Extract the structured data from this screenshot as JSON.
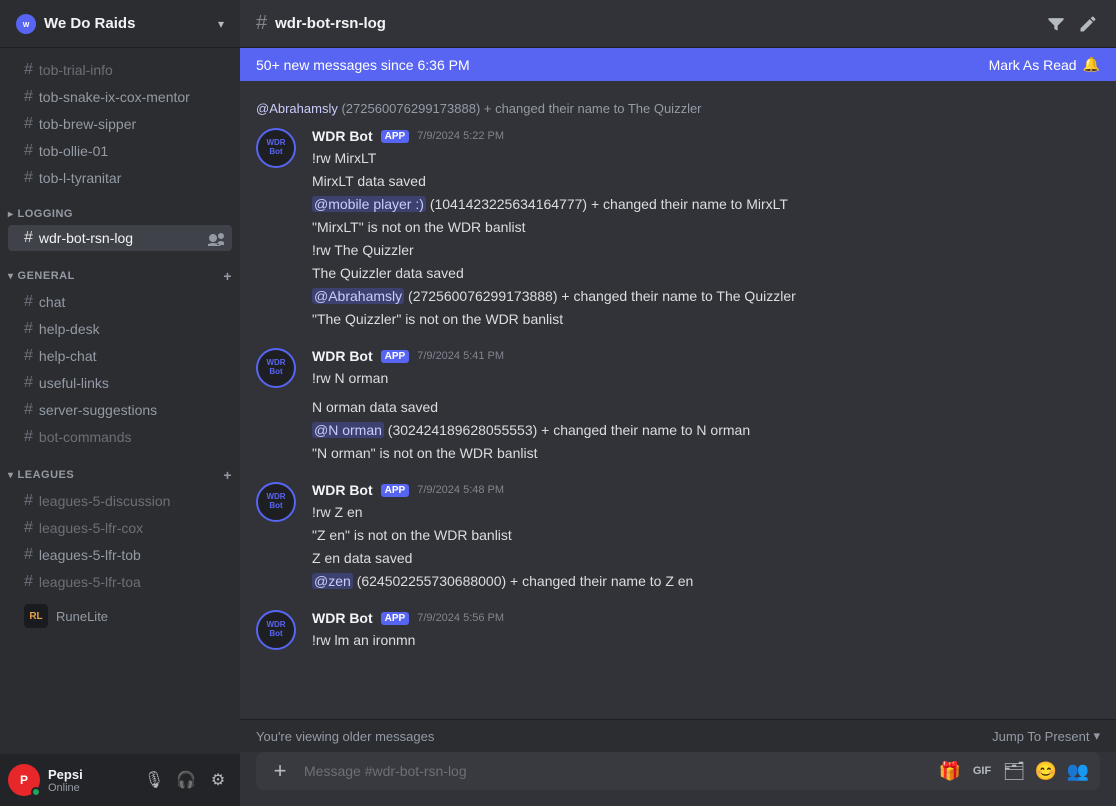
{
  "server": {
    "name": "We Do Raids",
    "icon_label": "WD"
  },
  "sidebar": {
    "channels_top": [
      {
        "name": "tob-trial-info",
        "muted": true
      },
      {
        "name": "tob-snake-ix-cox-mentor",
        "muted": false
      },
      {
        "name": "tob-brew-sipper",
        "muted": false
      },
      {
        "name": "tob-ollie-01",
        "muted": false
      },
      {
        "name": "tob-l-tyranitar",
        "muted": false
      }
    ],
    "categories": [
      {
        "name": "LOGGING",
        "channels": [
          {
            "name": "wdr-bot-rsn-log",
            "active": true
          }
        ]
      },
      {
        "name": "GENERAL",
        "channels": [
          {
            "name": "chat"
          },
          {
            "name": "help-desk"
          },
          {
            "name": "help-chat"
          },
          {
            "name": "useful-links"
          },
          {
            "name": "server-suggestions"
          },
          {
            "name": "bot-commands",
            "muted": true
          }
        ]
      },
      {
        "name": "LEAGUES",
        "channels": [
          {
            "name": "leagues-5-discussion",
            "muted": true
          },
          {
            "name": "leagues-5-lfr-cox",
            "muted": true
          },
          {
            "name": "leagues-5-lfr-tob"
          },
          {
            "name": "leagues-5-lfr-toa",
            "muted": true
          }
        ]
      }
    ],
    "runelite": {
      "name": "RuneLite",
      "icon": "RL"
    }
  },
  "user": {
    "name": "Pepsi",
    "status": "Online",
    "avatar_bg": "#e8272a",
    "avatar_label": "P"
  },
  "channel": {
    "name": "wdr-bot-rsn-log"
  },
  "new_messages_banner": {
    "text": "50+ new messages since 6:36 PM",
    "mark_as_read": "Mark As Read"
  },
  "messages": [
    {
      "id": "msg0",
      "system": true,
      "text": "@Abrahamsly (272560076299173888) + changed their name to The Quizzler"
    },
    {
      "id": "msg1",
      "bot_name": "WDR Bot",
      "timestamp": "7/9/2024 5:22 PM",
      "lines": [
        {
          "type": "normal",
          "text": "!rw MirxLT"
        },
        {
          "type": "normal",
          "text": "MirxLT data saved"
        },
        {
          "type": "mention",
          "mention": "@mobile player :)",
          "mention_id": "(1041423225634164777)",
          "suffix": " + changed their name to MirxLT"
        },
        {
          "type": "normal",
          "text": "\"MirxLT\" is not on the WDR banlist"
        },
        {
          "type": "normal",
          "text": "!rw The Quizzler"
        },
        {
          "type": "normal",
          "text": "The Quizzler data saved"
        },
        {
          "type": "mention",
          "mention": "@Abrahamsly",
          "mention_id": "(272560076299173888)",
          "suffix": " + changed their name to The Quizzler"
        },
        {
          "type": "normal",
          "text": "\"The Quizzler\" is not on the WDR banlist"
        }
      ]
    },
    {
      "id": "msg2",
      "bot_name": "WDR Bot",
      "timestamp": "7/9/2024 5:41 PM",
      "lines": [
        {
          "type": "normal",
          "text": "!rw N orman"
        },
        {
          "type": "normal",
          "text": ""
        },
        {
          "type": "normal",
          "text": "N orman data saved"
        },
        {
          "type": "mention",
          "mention": "@N orman",
          "mention_id": "(302424189628055553)",
          "suffix": " + changed their name to N orman"
        },
        {
          "type": "normal",
          "text": "\"N orman\" is not on the WDR banlist"
        }
      ]
    },
    {
      "id": "msg3",
      "bot_name": "WDR Bot",
      "timestamp": "7/9/2024 5:48 PM",
      "lines": [
        {
          "type": "normal",
          "text": "!rw Z en"
        },
        {
          "type": "normal",
          "text": "\"Z en\" is not on the WDR banlist"
        },
        {
          "type": "normal",
          "text": "Z en data saved"
        },
        {
          "type": "mention",
          "mention": "@zen",
          "mention_id": "(624502255730688000)",
          "suffix": " + changed their name to Z en"
        }
      ]
    },
    {
      "id": "msg4",
      "bot_name": "WDR Bot",
      "timestamp": "7/9/2024 5:56 PM",
      "lines": [
        {
          "type": "normal",
          "text": "!rw lm an ironmn"
        }
      ]
    }
  ],
  "older_messages_bar": {
    "text": "You're viewing older messages",
    "jump": "Jump To Present"
  },
  "input": {
    "placeholder": "Message #wdr-bot-rsn-log"
  },
  "icons": {
    "hash": "#",
    "chevron_down": "▾",
    "add": "+",
    "pencil": "✏",
    "filter": "⊞",
    "at": "@",
    "mic": "🎙",
    "headphones": "🎧",
    "settings": "⚙",
    "gift": "🎁",
    "gif": "GIF",
    "sticker": "🗂",
    "emoji": "😊",
    "people": "👥",
    "bell": "🔔"
  }
}
